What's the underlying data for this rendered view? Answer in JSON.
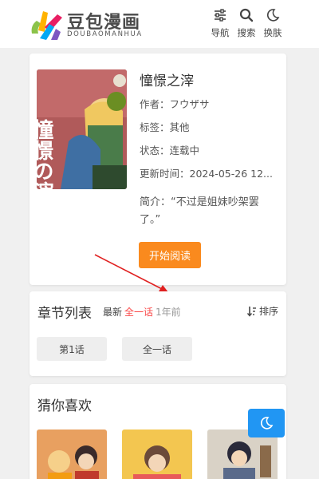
{
  "header": {
    "title": "豆包漫画",
    "subtitle": "DOUBAOMANHUA",
    "nav": [
      {
        "label": "导航",
        "icon": "sliders-icon"
      },
      {
        "label": "搜索",
        "icon": "search-icon"
      },
      {
        "label": "换肤",
        "icon": "moon-icon"
      }
    ]
  },
  "comic": {
    "title": "憧憬之滓",
    "cover_text": "憧憬の滓",
    "author": "作者：フウザサ",
    "tag": "标签：其他",
    "status": "状态：连载中",
    "updated": "更新时间：2024-05-26 12...",
    "intro": "简介：“不过是姐妹吵架罢了。”",
    "read_button": "开始阅读"
  },
  "chapters": {
    "title": "章节列表",
    "latest_label": "最新",
    "latest_chapter": "全一话",
    "latest_time": "1年前",
    "sort_label": "排序",
    "items": [
      "第1话",
      "全一话"
    ]
  },
  "recommend": {
    "title": "猜你喜欢"
  },
  "colors": {
    "accent": "#fa8a1e",
    "latest": "#fa4a4a",
    "theme_button": "#2196f3"
  }
}
